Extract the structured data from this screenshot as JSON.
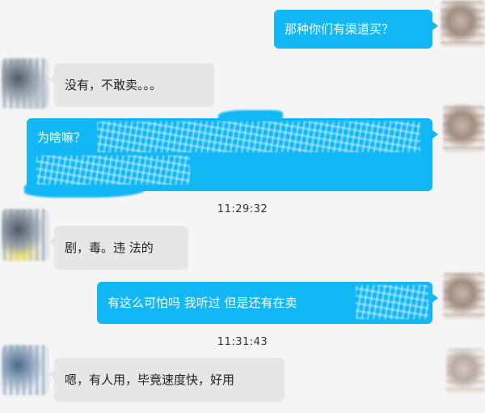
{
  "messages": [
    {
      "side": "right",
      "text": "那种你们有渠道买？"
    },
    {
      "side": "left",
      "text": "没有，不敢卖。。。"
    },
    {
      "side": "right",
      "text": "为啥嘛？"
    },
    {
      "side": "left",
      "text": "剧，毒。违 法的"
    },
    {
      "side": "right",
      "text": "有这么可怕吗 我听过 但是还有在卖"
    },
    {
      "side": "left",
      "text": "嗯，有人用，毕竟速度快，好用"
    }
  ],
  "timestamps": [
    "11:29:32",
    "11:31:43"
  ],
  "colors": {
    "sent_bubble": "#12b7f5",
    "received_bubble": "#e6e6e6",
    "background": "#f5f5f5"
  }
}
